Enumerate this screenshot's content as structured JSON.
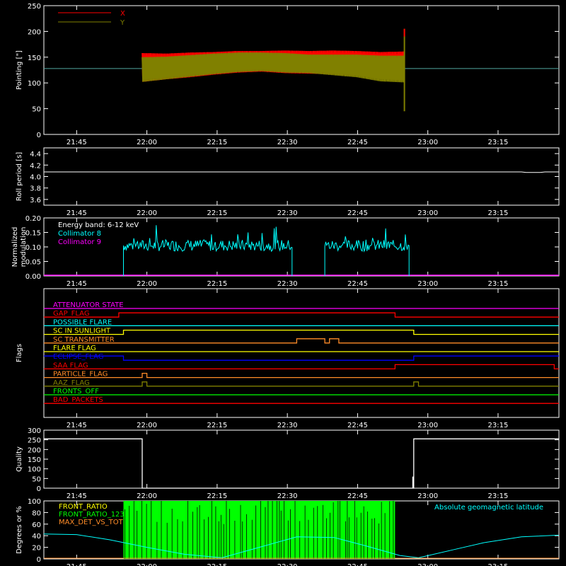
{
  "colors": {
    "background": "#000000",
    "axis": "#ffffff",
    "red": "#ff0000",
    "olive": "#808000",
    "green": "#00ff00",
    "cyan": "#00ffff",
    "magenta": "#ff00ff",
    "yellow": "#ffff00",
    "blue": "#0000ff",
    "orange": "#ff8c28"
  },
  "time_ticks": [
    "21:45",
    "22:00",
    "22:15",
    "22:30",
    "22:45",
    "23:00",
    "23:15"
  ],
  "chart_data": [
    {
      "id": "pointing",
      "type": "line",
      "ylabel": "Pointing [\"]",
      "ylim": [
        0,
        250
      ],
      "yticks": [
        "0",
        "50",
        "100",
        "150",
        "200",
        "250"
      ],
      "xrange": [
        "21:38",
        "23:28"
      ],
      "legend": [
        {
          "label": "X",
          "color": "#ff0000"
        },
        {
          "label": "Y",
          "color": "#808000"
        }
      ],
      "series": [
        {
          "name": "X",
          "color": "#ff0000",
          "start": "21:59",
          "end": "22:55",
          "center": [
            130,
            132,
            135,
            138,
            141,
            142,
            141,
            140,
            140,
            138,
            134,
            133
          ],
          "half_width": [
            28,
            25,
            24,
            22,
            21,
            20,
            22,
            22,
            23,
            24,
            26,
            28
          ]
        },
        {
          "name": "Y",
          "color": "#808000",
          "start": "21:59",
          "end": "22:55",
          "center": [
            126,
            129,
            133,
            137,
            140,
            141,
            139,
            137,
            135,
            133,
            128,
            127
          ],
          "half_width": [
            24,
            22,
            21,
            20,
            19,
            18,
            19,
            18,
            20,
            22,
            25,
            26
          ]
        }
      ],
      "reference_level": 128
    },
    {
      "id": "roll_period",
      "type": "line",
      "ylabel": "Roll period [s]",
      "ylim": [
        3.5,
        4.5
      ],
      "yticks": [
        "3.6",
        "3.8",
        "4.0",
        "4.2",
        "4.4"
      ],
      "series": [
        {
          "name": "",
          "color": "#ffffff",
          "x": [
            "21:38",
            "23:20",
            "23:21",
            "23:24",
            "23:25",
            "23:28"
          ],
          "y": [
            4.08,
            4.08,
            4.07,
            4.07,
            4.08,
            4.08
          ]
        }
      ]
    },
    {
      "id": "modulation",
      "type": "line",
      "ylabel": "Normalized modulation",
      "ylim": [
        0,
        0.2
      ],
      "yticks": [
        "0.00",
        "0.05",
        "0.10",
        "0.15",
        "0.20"
      ],
      "annotation": "Energy band: 6-12 keV",
      "legend": [
        {
          "label": "Collimator 8",
          "color": "#00ffff"
        },
        {
          "label": "Collimator 9",
          "color": "#ff00ff"
        }
      ],
      "series": [
        {
          "name": "Collimator 8",
          "color": "#00ffff",
          "segments": [
            [
              "21:55",
              "22:31"
            ],
            [
              "22:38",
              "22:56"
            ]
          ],
          "level": 0.105,
          "noise": 0.02
        }
      ]
    },
    {
      "id": "flags",
      "type": "line",
      "ylabel": "Flags",
      "series": [
        {
          "name": "ATTENUATOR STATE",
          "color": "#ff00ff",
          "x": [
            "21:38",
            "23:28"
          ],
          "y": [
            0,
            0
          ]
        },
        {
          "name": "GAP_FLAG",
          "color": "#ff0000",
          "x": [
            "21:38",
            "21:54",
            "21:54",
            "22:53",
            "22:53",
            "23:28"
          ],
          "y": [
            0,
            0,
            1,
            1,
            0,
            0
          ]
        },
        {
          "name": "POSSIBLE FLARE",
          "color": "#00ffff",
          "x": [
            "21:38",
            "23:28"
          ],
          "y": [
            0,
            0
          ]
        },
        {
          "name": "SC IN SUNLIGHT",
          "color": "#ffff00",
          "x": [
            "21:38",
            "21:55",
            "21:55",
            "22:57",
            "22:57",
            "23:28"
          ],
          "y": [
            0,
            0,
            1,
            1,
            0,
            0
          ]
        },
        {
          "name": "SC TRANSMITTER",
          "color": "#ff8c28",
          "x": [
            "21:38",
            "22:32",
            "22:32",
            "22:38",
            "22:38",
            "22:39",
            "22:39",
            "22:41",
            "22:41",
            "23:28"
          ],
          "y": [
            0,
            0,
            1,
            1,
            0,
            0,
            1,
            1,
            0,
            0
          ]
        },
        {
          "name": "FLARE FLAG",
          "color": "#ffff00",
          "x": [
            "21:38",
            "23:28"
          ],
          "y": [
            0,
            0
          ]
        },
        {
          "name": "ECLIPSE_FLAG",
          "color": "#0000ff",
          "x": [
            "21:38",
            "21:55",
            "21:55",
            "22:57",
            "22:57",
            "23:28"
          ],
          "y": [
            1,
            1,
            0,
            0,
            1,
            1
          ]
        },
        {
          "name": "SAA FLAG",
          "color": "#ff0000",
          "x": [
            "21:38",
            "22:53",
            "22:53",
            "23:27",
            "23:27",
            "23:28"
          ],
          "y": [
            0,
            0,
            1,
            1,
            0,
            0
          ]
        },
        {
          "name": "PARTICLE_FLAG",
          "color": "#ff8c28",
          "x": [
            "21:38",
            "21:59",
            "21:59",
            "22:00",
            "22:00",
            "23:28"
          ],
          "y": [
            0,
            0,
            1,
            1,
            0,
            0
          ]
        },
        {
          "name": "AAZ_FLAG",
          "color": "#808000",
          "x": [
            "21:38",
            "21:59",
            "21:59",
            "22:00",
            "22:00",
            "22:57",
            "22:57",
            "22:58",
            "22:58",
            "23:28"
          ],
          "y": [
            0,
            0,
            1,
            1,
            0,
            0,
            1,
            1,
            0,
            0
          ]
        },
        {
          "name": "FRONTS_OFF",
          "color": "#00ff00",
          "x": [
            "21:38",
            "23:28"
          ],
          "y": [
            0,
            0
          ]
        },
        {
          "name": "BAD_PACKETS",
          "color": "#ff0000",
          "x": [
            "21:38",
            "23:28"
          ],
          "y": [
            0,
            0
          ]
        }
      ]
    },
    {
      "id": "quality",
      "type": "line",
      "ylabel": "Quality",
      "ylim": [
        0,
        300
      ],
      "yticks": [
        "0",
        "50",
        "100",
        "150",
        "200",
        "250",
        "300"
      ],
      "series": [
        {
          "name": "",
          "color": "#ffffff",
          "x": [
            "21:38",
            "21:59",
            "21:59",
            "22:57",
            "22:57",
            "23:28"
          ],
          "y": [
            255,
            255,
            0,
            0,
            255,
            255
          ]
        }
      ]
    },
    {
      "id": "geomagnetic",
      "type": "line",
      "ylabel": "Degrees or %",
      "ylim": [
        0,
        100
      ],
      "yticks": [
        "0",
        "20",
        "40",
        "60",
        "80",
        "100"
      ],
      "legend": [
        {
          "label": "FRONT_RATIO",
          "color": "#ffff00"
        },
        {
          "label": "FRONT_RATIO_123",
          "color": "#00ff00"
        },
        {
          "label": "MAX_DET_VS_TOT",
          "color": "#ff8c28"
        }
      ],
      "annotation": "Absolute geomagnetic latitude",
      "series": [
        {
          "name": "FRONT_RATIO_123",
          "color": "#00ff00",
          "start": "21:55",
          "end": "22:53",
          "value": 100
        },
        {
          "name": "Absolute geomagnetic latitude",
          "color": "#00ffff",
          "x": [
            "21:38",
            "21:45",
            "21:52",
            "22:00",
            "22:08",
            "22:16",
            "22:24",
            "22:32",
            "22:40",
            "22:47",
            "22:54",
            "22:58",
            "23:05",
            "23:12",
            "23:20",
            "23:28"
          ],
          "y": [
            43,
            42,
            33,
            20,
            8,
            2,
            20,
            38,
            37,
            22,
            6,
            2,
            15,
            28,
            38,
            41
          ]
        }
      ]
    }
  ]
}
